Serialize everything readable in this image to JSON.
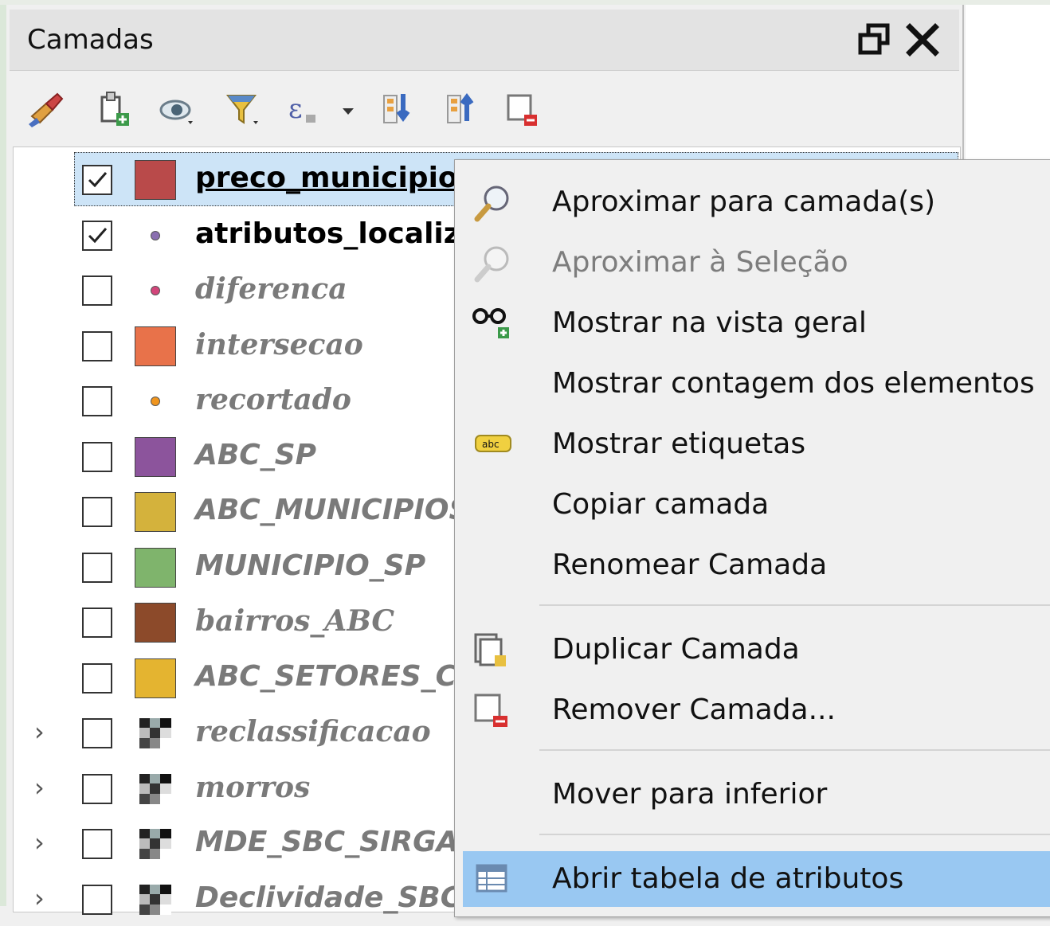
{
  "panel": {
    "title": "Camadas"
  },
  "toolbar": {
    "icons": [
      "style-brush-icon",
      "add-group-icon",
      "visibility-eye-icon",
      "filter-funnel-icon",
      "expression-filter-icon",
      "expand-all-icon",
      "collapse-all-icon",
      "remove-layer-icon"
    ]
  },
  "layers": [
    {
      "name": "preco_municipio",
      "checked": true,
      "symbol": "polygon",
      "color": "#b94a4a"
    },
    {
      "name": "atributos_localizac",
      "checked": true,
      "symbol": "point",
      "color": "#8a6fb0"
    },
    {
      "name": "diferenca",
      "checked": false,
      "symbol": "point",
      "color": "#d2457a"
    },
    {
      "name": "intersecao",
      "checked": false,
      "symbol": "polygon",
      "color": "#e8724a"
    },
    {
      "name": "recortado",
      "checked": false,
      "symbol": "point",
      "color": "#f0951e"
    },
    {
      "name": "ABC_SP",
      "checked": false,
      "symbol": "polygon",
      "color": "#8c549c"
    },
    {
      "name": "ABC_MUNICIPIOS",
      "checked": false,
      "symbol": "polygon",
      "color": "#d4b23c"
    },
    {
      "name": "MUNICIPIO_SP",
      "checked": false,
      "symbol": "polygon",
      "color": "#7fb46c"
    },
    {
      "name": "bairros_ABC",
      "checked": false,
      "symbol": "polygon",
      "color": "#8c4a2a"
    },
    {
      "name": "ABC_SETORES_CE",
      "checked": false,
      "symbol": "polygon",
      "color": "#e4b430"
    },
    {
      "name": "reclassificacao",
      "checked": false,
      "symbol": "raster",
      "color": "#333333"
    },
    {
      "name": "morros",
      "checked": false,
      "symbol": "raster",
      "color": "#333333"
    },
    {
      "name": "MDE_SBC_SIRGAS",
      "checked": false,
      "symbol": "raster",
      "color": "#333333"
    },
    {
      "name": "Declividade_SBC",
      "checked": false,
      "symbol": "raster",
      "color": "#333333"
    }
  ],
  "context_menu": {
    "items": [
      {
        "label": "Aproximar para camada(s)",
        "icon": "zoom-to-layer-icon",
        "enabled": true
      },
      {
        "label": "Aproximar à Seleção",
        "icon": "zoom-to-selection-icon",
        "enabled": false
      },
      {
        "label": "Mostrar na vista geral",
        "icon": "overview-glasses-icon",
        "enabled": true
      },
      {
        "label": "Mostrar contagem dos elementos",
        "icon": "",
        "enabled": true
      },
      {
        "label": "Mostrar etiquetas",
        "icon": "labels-abc-icon",
        "enabled": true
      },
      {
        "label": "Copiar camada",
        "icon": "",
        "enabled": true
      },
      {
        "label": "Renomear Camada",
        "icon": "",
        "enabled": true
      },
      {
        "label": "Duplicar Camada",
        "icon": "duplicate-layer-icon",
        "enabled": true
      },
      {
        "label": "Remover Camada...",
        "icon": "remove-layer-icon",
        "enabled": true
      },
      {
        "label": "Mover para inferior",
        "icon": "",
        "enabled": true
      },
      {
        "label": "Abrir tabela de atributos",
        "icon": "attribute-table-icon",
        "enabled": true,
        "highlighted": true
      }
    ]
  }
}
